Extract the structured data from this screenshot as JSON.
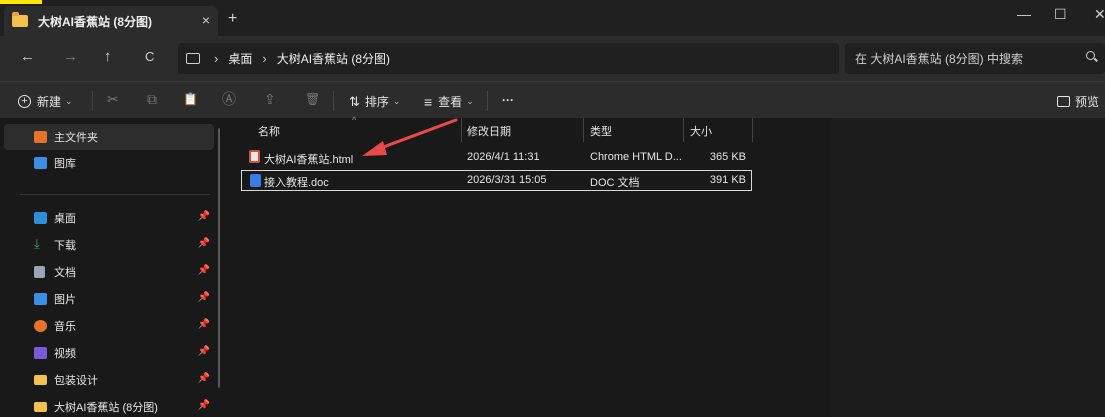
{
  "tab": {
    "title": "大树AI香蕉站 (8分图)",
    "close_glyph": "×",
    "new_glyph": "+"
  },
  "window": {
    "minimize": "—",
    "maximize": "☐",
    "close": "✕"
  },
  "nav": {
    "back": "←",
    "forward": "→",
    "up": "↑",
    "refresh": "C"
  },
  "address": {
    "crumbs": [
      "桌面",
      "大树AI香蕉站 (8分图)"
    ],
    "separator": "›"
  },
  "search": {
    "placeholder": "在 大树AI香蕉站 (8分图) 中搜索"
  },
  "toolbar": {
    "new_label": "新建",
    "sort_label": "排序",
    "view_label": "查看",
    "more_label": "···",
    "preview_label": "预览",
    "cut_glyph": "✂",
    "copy_glyph": "⧉",
    "paste_glyph": "📋",
    "rename_glyph": "Ⓐ",
    "share_glyph": "⇪",
    "delete_glyph": "🗑",
    "sort_glyph": "⇅",
    "view_glyph": "≡"
  },
  "sidebar": {
    "items": [
      {
        "label": "主文件夹",
        "icon": "home-icon",
        "color": "#e8712b"
      },
      {
        "label": "图库",
        "icon": "gallery-icon",
        "color": "#3a8ee6"
      },
      {
        "label": "桌面",
        "icon": "desktop-icon",
        "color": "#2e8fd8"
      },
      {
        "label": "下载",
        "icon": "download-icon",
        "color": "#2fb35a"
      },
      {
        "label": "文档",
        "icon": "documents-icon",
        "color": "#9aa4b4"
      },
      {
        "label": "图片",
        "icon": "pictures-icon",
        "color": "#3a8ee6"
      },
      {
        "label": "音乐",
        "icon": "music-icon",
        "color": "#e8712b"
      },
      {
        "label": "视频",
        "icon": "videos-icon",
        "color": "#7a5ad8"
      },
      {
        "label": "包装设计",
        "icon": "folder-icon",
        "color": "#f2c14e"
      },
      {
        "label": "大树AI香蕉站 (8分图)",
        "icon": "folder-icon",
        "color": "#f2c14e"
      }
    ],
    "pin_glyph": "📌"
  },
  "columns": {
    "name": "名称",
    "modified": "修改日期",
    "type": "类型",
    "size": "大小"
  },
  "files": [
    {
      "name": "大树AI香蕉站.html",
      "modified": "2026/4/1 11:31",
      "type": "Chrome HTML D...",
      "size": "365 KB",
      "icon": "chrome-html-icon",
      "color": "#d94b3a"
    },
    {
      "name": "接入教程.doc",
      "modified": "2026/3/31 15:05",
      "type": "DOC 文档",
      "size": "391 KB",
      "icon": "word-doc-icon",
      "color": "#3a7be6"
    }
  ],
  "annotation": {
    "color": "#e84a4a"
  }
}
